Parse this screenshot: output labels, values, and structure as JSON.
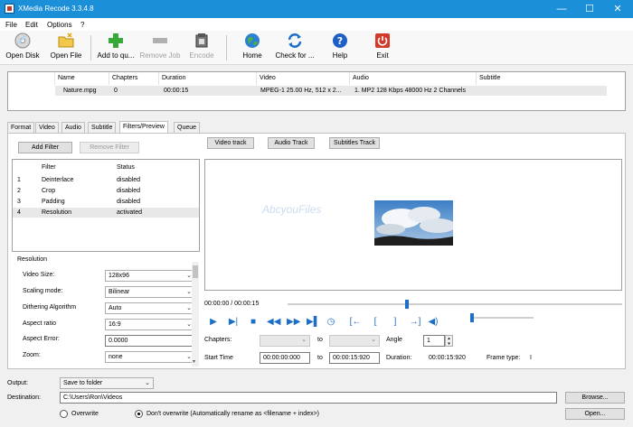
{
  "window": {
    "title": "XMedia Recode 3.3.4.8",
    "minimize": "—",
    "maximize": "☐",
    "close": "✕"
  },
  "menu": [
    "File",
    "Edit",
    "Options",
    "?"
  ],
  "toolbar": {
    "open_disk": "Open Disk",
    "open_file": "Open File",
    "add_to_queue": "Add to qu...",
    "remove_job": "Remove Job",
    "encode": "Encode",
    "home": "Home",
    "check_for": "Check for ...",
    "help": "Help",
    "exit": "Exit"
  },
  "file_table": {
    "headers": [
      "Name",
      "Chapters",
      "Duration",
      "Video",
      "Audio",
      "Subtitle"
    ],
    "row": {
      "name": "Nature.mpg",
      "chapters": "0",
      "duration": "00:00:15",
      "video": "MPEG-1 25.00 Hz, 512 x 2...",
      "audio": "1. MP2 128 Kbps 48000 Hz 2 Channels",
      "subtitle": ""
    }
  },
  "tabs": [
    "Format",
    "Video",
    "Audio",
    "Subtitle",
    "Filters/Preview",
    "Queue"
  ],
  "filters": {
    "add_filter": "Add Filter",
    "remove_filter": "Remove Filter",
    "col_filter": "Filter",
    "col_status": "Status",
    "rows": [
      {
        "n": "1",
        "filter": "Deinterlace",
        "status": "disabled"
      },
      {
        "n": "2",
        "filter": "Crop",
        "status": "disabled"
      },
      {
        "n": "3",
        "filter": "Padding",
        "status": "disabled"
      },
      {
        "n": "4",
        "filter": "Resolution",
        "status": "activated"
      }
    ]
  },
  "resolution": {
    "group_title": "Resolution",
    "video_size_label": "Video Size:",
    "video_size": "128x96",
    "scaling_label": "Scaling mode:",
    "scaling": "Bilinear",
    "dithering_label": "Dithering Algorithm",
    "dithering": "Auto",
    "aspect_ratio_label": "Aspect ratio",
    "aspect_ratio": "16:9",
    "aspect_error_label": "Aspect Error:",
    "aspect_error": "0.0000",
    "zoom_label": "Zoom:",
    "zoom": "none"
  },
  "preview": {
    "video_track": "Video track",
    "audio_track": "Audio Track",
    "subtitles_track": "Subtitles Track",
    "watermark": "AbcyouFiles",
    "time": "00:00:00 / 00:00:15",
    "position": 0.35,
    "volume": 0.0,
    "chapters_label": "Chapters:",
    "to1": "to",
    "angle_label": "Angle",
    "angle": "1",
    "start_time_label": "Start Time",
    "start_time": "00:00:00:000",
    "to2": "to",
    "end_time": "00:00:15:920",
    "duration_label": "Duration:",
    "duration": "00:00:15:920",
    "frame_type_label": "Frame type:",
    "frame_type": "I"
  },
  "output": {
    "output_label": "Output:",
    "output_value": "Save to folder",
    "destination_label": "Destination:",
    "destination": "C:\\Users\\Ron\\Videos",
    "browse": "Browse...",
    "open": "Open...",
    "overwrite": "Overwrite",
    "dont_overwrite": "Don't overwrite (Automatically rename as <filename + index>)"
  }
}
